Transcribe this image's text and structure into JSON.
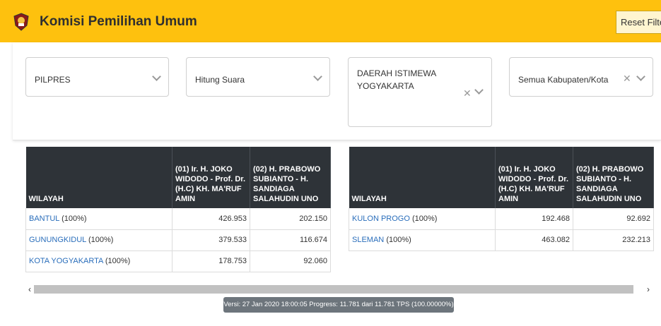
{
  "header": {
    "title": "Komisi Pemilihan Umum",
    "reset_label": "Reset Filter",
    "brand_color": "#fec10e"
  },
  "filters": {
    "election": "PILPRES",
    "type": "Hitung Suara",
    "province": "DAERAH ISTIMEWA YOGYAKARTA",
    "regency": "Semua Kabupaten/Kota"
  },
  "table_headers": {
    "region": "WILAYAH",
    "candidate1": "(01) Ir. H. JOKO WIDODO - Prof. Dr. (H.C) KH. MA'RUF AMIN",
    "candidate2": "(02) H. PRABOWO SUBIANTO - H. SANDIAGA SALAHUDIN UNO"
  },
  "left_table": [
    {
      "region": "BANTUL",
      "pct": "(100%)",
      "c1": "426.953",
      "c2": "202.150"
    },
    {
      "region": "GUNUNGKIDUL",
      "pct": "(100%)",
      "c1": "379.533",
      "c2": "116.674"
    },
    {
      "region": "KOTA YOGYAKARTA",
      "pct": "(100%)",
      "c1": "178.753",
      "c2": "92.060"
    }
  ],
  "right_table": [
    {
      "region": "KULON PROGO",
      "pct": "(100%)",
      "c1": "192.468",
      "c2": "92.692"
    },
    {
      "region": "SLEMAN",
      "pct": "(100%)",
      "c1": "463.082",
      "c2": "232.213"
    }
  ],
  "footer": {
    "version": "Versi: 27 Jan 2020 18:00:05 Progress: 11.781 dari 11.781 TPS (100.00000%)"
  }
}
